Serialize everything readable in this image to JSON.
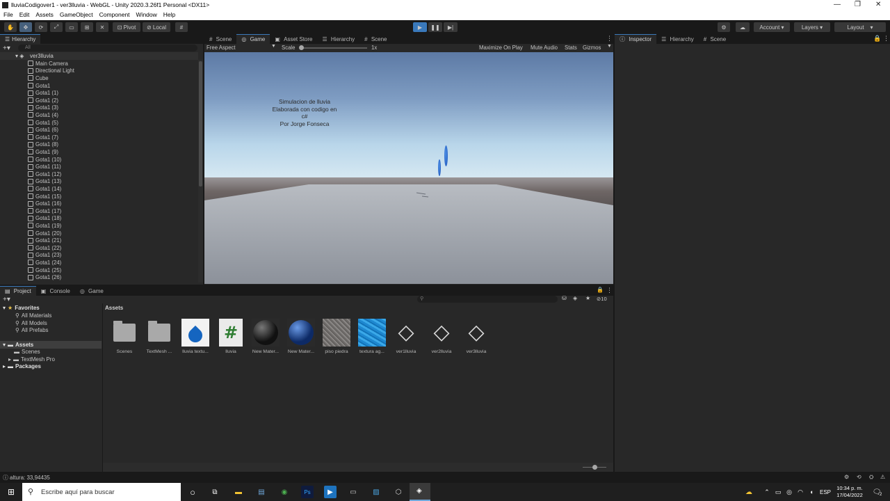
{
  "window": {
    "title": "lluviaCodigover1 - ver3lluvia - WebGL - Unity 2020.3.26f1 Personal <DX11>",
    "controls": [
      "—",
      "❐",
      "✕"
    ]
  },
  "menu": [
    "File",
    "Edit",
    "Assets",
    "GameObject",
    "Component",
    "Window",
    "Help"
  ],
  "toolbar": {
    "pivot": "Pivot",
    "local": "Local",
    "account": "Account",
    "layers": "Layers",
    "layout": "Layout"
  },
  "hierarchy": {
    "tab": "Hierarchy",
    "search_placeholder": "All",
    "scene": "ver3lluvia",
    "items": [
      "Main Camera",
      "Directional Light",
      "Cube",
      "Gota1",
      "Gota1 (1)",
      "Gota1 (2)",
      "Gota1 (3)",
      "Gota1 (4)",
      "Gota1 (5)",
      "Gota1 (6)",
      "Gota1 (7)",
      "Gota1 (8)",
      "Gota1 (9)",
      "Gota1 (10)",
      "Gota1 (11)",
      "Gota1 (12)",
      "Gota1 (13)",
      "Gota1 (14)",
      "Gota1 (15)",
      "Gota1 (16)",
      "Gota1 (17)",
      "Gota1 (18)",
      "Gota1 (19)",
      "Gota1 (20)",
      "Gota1 (21)",
      "Gota1 (22)",
      "Gota1 (23)",
      "Gota1 (24)",
      "Gota1 (25)",
      "Gota1 (26)"
    ]
  },
  "center_tabs": [
    "Scene",
    "Game",
    "Asset Store",
    "Hierarchy",
    "Scene"
  ],
  "game": {
    "aspect": "Free Aspect",
    "scale_label": "Scale",
    "scale_value": "1x",
    "options": [
      "Maximize On Play",
      "Mute Audio",
      "Stats",
      "Gizmos"
    ],
    "overlay_lines": [
      "Simulacion de lluvia",
      "Elaborada con codigo en",
      "c#",
      "Por Jorge Fonseca"
    ]
  },
  "right_tabs": [
    "Inspector",
    "Hierarchy",
    "Scene"
  ],
  "bottom_tabs": [
    "Project",
    "Console",
    "Game"
  ],
  "project": {
    "favorites": "Favorites",
    "favorite_items": [
      "All Materials",
      "All Models",
      "All Prefabs"
    ],
    "assets_root": "Assets",
    "asset_folders": [
      "Scenes",
      "TextMesh Pro"
    ],
    "packages": "Packages",
    "breadcrumb": "Assets",
    "hidden_count": "10",
    "assets": [
      {
        "name": "Scenes",
        "kind": "folder"
      },
      {
        "name": "TextMesh ...",
        "kind": "folder"
      },
      {
        "name": "lluvia textu...",
        "kind": "drop"
      },
      {
        "name": "lluvia",
        "kind": "script"
      },
      {
        "name": "New Mater...",
        "kind": "black-sphere"
      },
      {
        "name": "New Mater...",
        "kind": "blue-sphere"
      },
      {
        "name": "piso piedra",
        "kind": "stone"
      },
      {
        "name": "textura ag...",
        "kind": "water"
      },
      {
        "name": "ver1lluvia",
        "kind": "unity"
      },
      {
        "name": "ver2lluvia",
        "kind": "unity"
      },
      {
        "name": "ver3lluvia",
        "kind": "unity"
      }
    ]
  },
  "status": "altura: 33,94435",
  "taskbar": {
    "search_placeholder": "Escribe aquí para buscar",
    "lang": "ESP",
    "time": "10:34 p. m.",
    "date": "17/04/2022",
    "notifications": "2"
  },
  "colors": {
    "accent": "#3a79bb",
    "play_active": "#46607c",
    "panel": "#282828",
    "sky_top": "#5d7aa5",
    "sky_horizon": "#dcecf4",
    "floor": "#8c919a"
  }
}
